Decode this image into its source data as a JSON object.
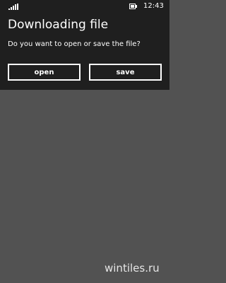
{
  "status_bar": {
    "time": "12:43",
    "signal_icon": "signal-strength-icon",
    "battery_icon": "battery-charging-icon"
  },
  "dialog": {
    "title": "Downloading file",
    "message": "Do you want to open or save the file?",
    "open_label": "open",
    "save_label": "save"
  },
  "watermark": "wintiles.ru",
  "colors": {
    "dialog_background": "#1f1f1f",
    "page_background": "#525252",
    "text": "#ffffff"
  }
}
